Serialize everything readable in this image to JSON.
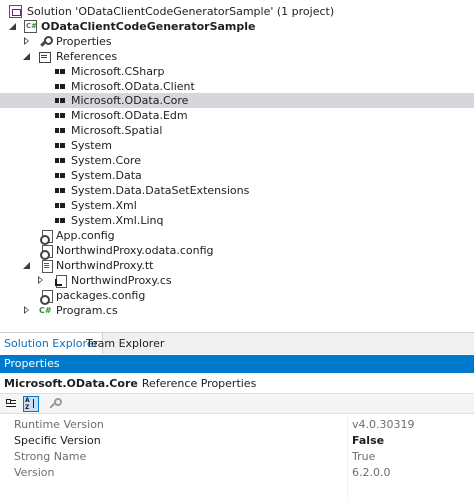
{
  "solution_explorer": {
    "rows": [
      {
        "label": "Solution 'ODataClientCodeGeneratorSample' (1 project)",
        "icon": "solution-icon",
        "toggle": "none",
        "bold": false
      },
      {
        "label": "ODataClientCodeGeneratorSample",
        "icon": "csharp-project-icon",
        "toggle": "expanded",
        "bold": true
      },
      {
        "label": "Properties",
        "icon": "wrench-icon",
        "toggle": "collapsed",
        "bold": false
      },
      {
        "label": "References",
        "icon": "references-icon",
        "toggle": "expanded",
        "bold": false
      },
      {
        "label": "Microsoft.CSharp",
        "icon": "assembly-reference-icon",
        "toggle": "none",
        "bold": false
      },
      {
        "label": "Microsoft.OData.Client",
        "icon": "assembly-reference-icon",
        "toggle": "none",
        "bold": false
      },
      {
        "label": "Microsoft.OData.Core",
        "icon": "assembly-reference-icon",
        "toggle": "none",
        "bold": false,
        "selected": true
      },
      {
        "label": "Microsoft.OData.Edm",
        "icon": "assembly-reference-icon",
        "toggle": "none",
        "bold": false
      },
      {
        "label": "Microsoft.Spatial",
        "icon": "assembly-reference-icon",
        "toggle": "none",
        "bold": false
      },
      {
        "label": "System",
        "icon": "assembly-reference-icon",
        "toggle": "none",
        "bold": false
      },
      {
        "label": "System.Core",
        "icon": "assembly-reference-icon",
        "toggle": "none",
        "bold": false
      },
      {
        "label": "System.Data",
        "icon": "assembly-reference-icon",
        "toggle": "none",
        "bold": false
      },
      {
        "label": "System.Data.DataSetExtensions",
        "icon": "assembly-reference-icon",
        "toggle": "none",
        "bold": false
      },
      {
        "label": "System.Xml",
        "icon": "assembly-reference-icon",
        "toggle": "none",
        "bold": false
      },
      {
        "label": "System.Xml.Linq",
        "icon": "assembly-reference-icon",
        "toggle": "none",
        "bold": false
      },
      {
        "label": "App.config",
        "icon": "config-file-icon",
        "toggle": "none",
        "bold": false
      },
      {
        "label": "NorthwindProxy.odata.config",
        "icon": "config-file-icon",
        "toggle": "none",
        "bold": false
      },
      {
        "label": "NorthwindProxy.tt",
        "icon": "template-file-icon",
        "toggle": "expanded",
        "bold": false
      },
      {
        "label": "NorthwindProxy.cs",
        "icon": "csharp-file-icon",
        "toggle": "collapsed",
        "bold": false
      },
      {
        "label": "packages.config",
        "icon": "config-file-icon",
        "toggle": "none",
        "bold": false
      },
      {
        "label": "Program.cs",
        "icon": "csharp-file-icon",
        "toggle": "collapsed",
        "bold": false
      }
    ]
  },
  "tabs": [
    {
      "label": "Solution Explorer",
      "active": true
    },
    {
      "label": "Team Explorer",
      "active": false
    }
  ],
  "properties": {
    "title": "Properties",
    "object_name": "Microsoft.OData.Core",
    "object_type": "Reference Properties",
    "toolbar": {
      "categorized_icon": "categorized-icon",
      "alphabetical_icon": "alphabetical-icon",
      "property_pages_icon": "property-pages-icon"
    },
    "rows": [
      {
        "name": "Runtime Version",
        "value": "v4.0.30319",
        "readonly": true
      },
      {
        "name": "Specific Version",
        "value": "False",
        "readonly": false
      },
      {
        "name": "Strong Name",
        "value": "True",
        "readonly": true
      },
      {
        "name": "Version",
        "value": "6.2.0.0",
        "readonly": true
      }
    ]
  },
  "colors": {
    "accent": "#007acc",
    "selected_row": "#d6d6dc",
    "active_tab_text": "#0e70c0"
  }
}
